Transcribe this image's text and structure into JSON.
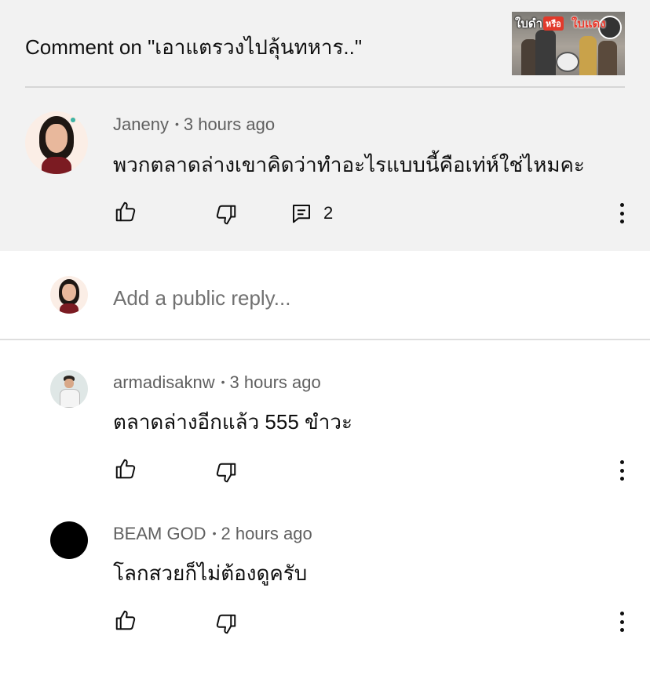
{
  "header": {
    "title": "Comment on \"เอาแตรวงไปลุ้นทหาร..\"",
    "thumbnail": {
      "text_left": "ใบดำ",
      "text_mid": "หรือ",
      "text_right": "ใบแดง"
    }
  },
  "main_comment": {
    "author": "Janeny",
    "time": "3 hours ago",
    "text": "พวกตลาดล่างเขาคิดว่าทำอะไรแบบนี้คือเท่ห์ใช่ไหมคะ",
    "reply_count": "2"
  },
  "reply_box": {
    "placeholder": "Add a public reply..."
  },
  "replies": [
    {
      "author": "armadisaknw",
      "time": "3 hours ago",
      "text": "ตลาดล่างอีกแล้ว 555 ขำวะ"
    },
    {
      "author": "BEAM GOD",
      "time": "2 hours ago",
      "text": "โลกสวยก็ไม่ต้องดูครับ"
    }
  ],
  "separator": "•",
  "icons": {
    "like": "thumbs-up-icon",
    "dislike": "thumbs-down-icon",
    "reply": "comment-icon",
    "more": "more-vert-icon"
  },
  "colors": {
    "header_bg": "#f2f2f2",
    "secondary_text": "#606060",
    "primary_text": "#0f0f0f"
  }
}
